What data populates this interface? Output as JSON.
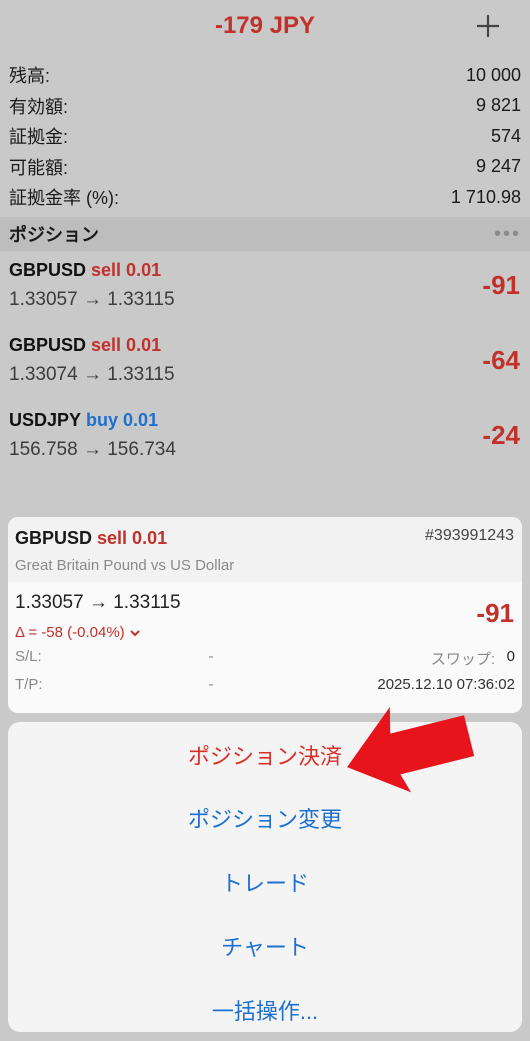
{
  "header": {
    "title": "-179 JPY",
    "add_icon": "plus-icon"
  },
  "account": [
    {
      "label": "残高:",
      "value": "10 000"
    },
    {
      "label": "有効額:",
      "value": "9 821"
    },
    {
      "label": "証拠金:",
      "value": "574"
    },
    {
      "label": "可能額:",
      "value": "9 247"
    },
    {
      "label": "証拠金率 (%):",
      "value": "1 710.98"
    }
  ],
  "positions_header": {
    "title": "ポジション",
    "more": "•••"
  },
  "positions": [
    {
      "symbol": "GBPUSD",
      "side": "sell 0.01",
      "prices": "1.33057 → 1.33115",
      "profit": "-91"
    },
    {
      "symbol": "GBPUSD",
      "side": "sell 0.01",
      "prices": "1.33074 → 1.33115",
      "profit": "-64"
    },
    {
      "symbol": "USDJPY",
      "side": "buy 0.01",
      "prices": "156.758 → 156.734",
      "profit": "-24"
    }
  ],
  "detail": {
    "symbol": "GBPUSD",
    "side": "sell 0.01",
    "ticket": "#393991243",
    "description": "Great Britain Pound vs US Dollar",
    "prices": "1.33057 → 1.33115",
    "delta": "Δ = -58 (-0.04%)",
    "profit": "-91",
    "sl_label": "S/L:",
    "sl_value": "-",
    "swap_label": "スワップ:",
    "swap_value": "0",
    "tp_label": "T/P:",
    "tp_value": "-",
    "time": "2025.12.10 07:36:02"
  },
  "menu": {
    "close_position": "ポジション決済",
    "modify_position": "ポジション変更",
    "trade": "トレード",
    "chart": "チャート",
    "bulk": "一括操作..."
  },
  "colors": {
    "loss": "#c0322b",
    "buy": "#1e6fd0",
    "action": "#1e6fd0",
    "annotation_arrow": "#e8141c"
  }
}
